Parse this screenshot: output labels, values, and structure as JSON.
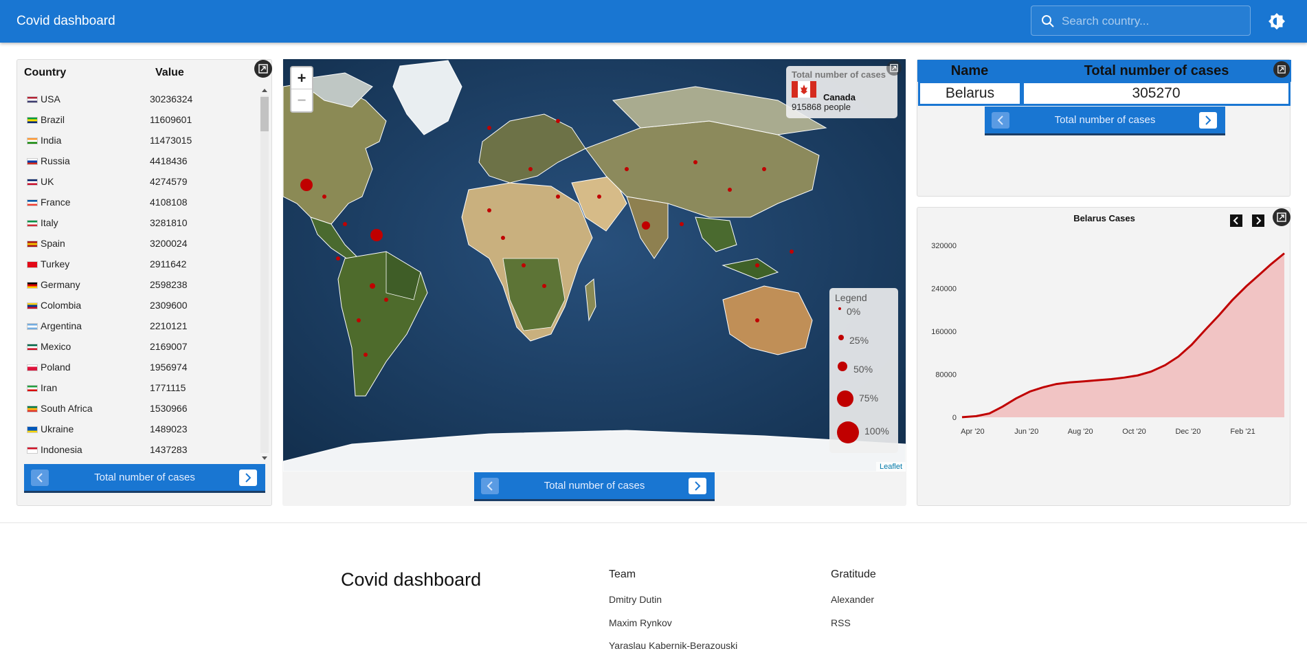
{
  "header": {
    "title": "Covid dashboard",
    "search_placeholder": "Search country..."
  },
  "country_list": {
    "col_country": "Country",
    "col_value": "Value",
    "rows": [
      {
        "name": "USA",
        "value": "30236324",
        "flag": [
          "#b22234",
          "#ffffff",
          "#3c3b6e"
        ]
      },
      {
        "name": "Brazil",
        "value": "11609601",
        "flag": [
          "#009c3b",
          "#ffdf00",
          "#002776"
        ]
      },
      {
        "name": "India",
        "value": "11473015",
        "flag": [
          "#ff9933",
          "#ffffff",
          "#138808"
        ]
      },
      {
        "name": "Russia",
        "value": "4418436",
        "flag": [
          "#ffffff",
          "#0039a6",
          "#d52b1e"
        ]
      },
      {
        "name": "UK",
        "value": "4274579",
        "flag": [
          "#012169",
          "#ffffff",
          "#c8102e"
        ]
      },
      {
        "name": "France",
        "value": "4108108",
        "flag": [
          "#0055a4",
          "#ffffff",
          "#ef4135"
        ]
      },
      {
        "name": "Italy",
        "value": "3281810",
        "flag": [
          "#009246",
          "#ffffff",
          "#ce2b37"
        ]
      },
      {
        "name": "Spain",
        "value": "3200024",
        "flag": [
          "#aa151b",
          "#f1bf00",
          "#aa151b"
        ]
      },
      {
        "name": "Turkey",
        "value": "2911642",
        "flag": [
          "#e30a17",
          "#e30a17",
          "#e30a17"
        ]
      },
      {
        "name": "Germany",
        "value": "2598238",
        "flag": [
          "#000000",
          "#dd0000",
          "#ffce00"
        ]
      },
      {
        "name": "Colombia",
        "value": "2309600",
        "flag": [
          "#fcd116",
          "#003893",
          "#ce1126"
        ]
      },
      {
        "name": "Argentina",
        "value": "2210121",
        "flag": [
          "#74acdf",
          "#ffffff",
          "#74acdf"
        ]
      },
      {
        "name": "Mexico",
        "value": "2169007",
        "flag": [
          "#006847",
          "#ffffff",
          "#ce1126"
        ]
      },
      {
        "name": "Poland",
        "value": "1956974",
        "flag": [
          "#ffffff",
          "#dc143c",
          "#dc143c"
        ]
      },
      {
        "name": "Iran",
        "value": "1771115",
        "flag": [
          "#239f40",
          "#ffffff",
          "#da0000"
        ]
      },
      {
        "name": "South Africa",
        "value": "1530966",
        "flag": [
          "#007a4d",
          "#ffb612",
          "#de3831"
        ]
      },
      {
        "name": "Ukraine",
        "value": "1489023",
        "flag": [
          "#0057b7",
          "#0057b7",
          "#ffd700"
        ]
      },
      {
        "name": "Indonesia",
        "value": "1437283",
        "flag": [
          "#ce1126",
          "#ffffff",
          "#ffffff"
        ]
      }
    ],
    "switcher_label": "Total number of cases"
  },
  "map": {
    "info_title": "Total number of cases",
    "info_country": "Canada",
    "info_value": "915868 people",
    "legend_title": "Legend",
    "legend_items": [
      "0%",
      "25%",
      "50%",
      "75%",
      "100%"
    ],
    "zoom_in": "+",
    "zoom_out": "−",
    "attribution": "Leaflet",
    "switcher_label": "Total number of cases"
  },
  "summary_table": {
    "col_name": "Name",
    "col_total": "Total number of cases",
    "name": "Belarus",
    "total": "305270",
    "switcher_label": "Total number of cases"
  },
  "chart_data": {
    "type": "area",
    "title": "Belarus Cases",
    "xlabel": "",
    "ylabel": "",
    "x_ticks": [
      "Apr '20",
      "Jun '20",
      "Aug '20",
      "Oct '20",
      "Dec '20",
      "Feb '21"
    ],
    "y_ticks": [
      0,
      80000,
      160000,
      240000,
      320000
    ],
    "ylim": [
      0,
      320000
    ],
    "x": [
      "2020-03-20",
      "2020-04-05",
      "2020-04-20",
      "2020-05-05",
      "2020-05-20",
      "2020-06-05",
      "2020-06-20",
      "2020-07-05",
      "2020-07-20",
      "2020-08-05",
      "2020-08-20",
      "2020-09-05",
      "2020-09-20",
      "2020-10-05",
      "2020-10-20",
      "2020-11-05",
      "2020-11-20",
      "2020-12-05",
      "2020-12-20",
      "2021-01-05",
      "2021-01-20",
      "2021-02-05",
      "2021-02-20",
      "2021-03-05",
      "2021-03-20"
    ],
    "series": [
      {
        "values": [
          100,
          2000,
          7000,
          20000,
          35000,
          48000,
          56000,
          62000,
          65000,
          67000,
          69000,
          71000,
          74000,
          78000,
          85000,
          97000,
          113000,
          135000,
          162000,
          190000,
          218000,
          244000,
          266000,
          285000,
          305270
        ]
      }
    ],
    "colors": {
      "line": "#c00000",
      "fill": "#f0b8b8"
    }
  },
  "footer": {
    "title": "Covid dashboard",
    "team_heading": "Team",
    "team": [
      "Dmitry Dutin",
      "Maxim Rynkov",
      "Yaraslau Kabernik-Berazouski"
    ],
    "gratitude_heading": "Gratitude",
    "gratitude": [
      "Alexander",
      "RSS"
    ]
  },
  "colors": {
    "primary": "#1976d2",
    "marker": "#c00000"
  },
  "icons": {
    "search": "search-icon",
    "theme": "brightness-icon",
    "expand": "expand-icon",
    "prev": "chevron-left-icon",
    "next": "chevron-right-icon"
  }
}
